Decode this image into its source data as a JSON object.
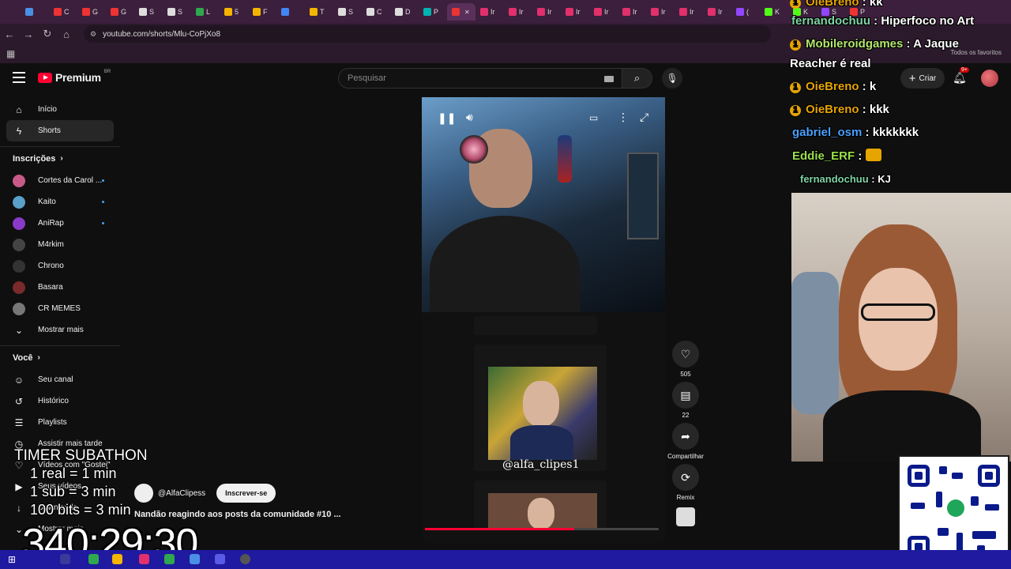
{
  "browser": {
    "url": "youtube.com/shorts/Mlu-CoPjXo8",
    "bookmarks_label": "Todos os favoritos",
    "tabs": [
      {
        "letter": "",
        "color": "#4a8fe6"
      },
      {
        "letter": "C",
        "color": "#ee3333"
      },
      {
        "letter": "G",
        "color": "#ee3333"
      },
      {
        "letter": "G",
        "color": "#ee3333"
      },
      {
        "letter": "S",
        "color": "#dddddd"
      },
      {
        "letter": "S",
        "color": "#dddddd"
      },
      {
        "letter": "L",
        "color": "#2fa84f"
      },
      {
        "letter": "5",
        "color": "#f4b400"
      },
      {
        "letter": "F",
        "color": "#f4b400"
      },
      {
        "letter": "",
        "color": "#4285f4"
      },
      {
        "letter": "T",
        "color": "#f4b400"
      },
      {
        "letter": "S",
        "color": "#dddddd"
      },
      {
        "letter": "C",
        "color": "#dddddd"
      },
      {
        "letter": "D",
        "color": "#dddddd"
      },
      {
        "letter": "P",
        "color": "#00b3b3"
      },
      {
        "letter": "",
        "color": "#ee3333",
        "active": true
      },
      {
        "letter": "Ir",
        "color": "#e1306c"
      },
      {
        "letter": "Ir",
        "color": "#e1306c"
      },
      {
        "letter": "Ir",
        "color": "#e1306c"
      },
      {
        "letter": "Ir",
        "color": "#e1306c"
      },
      {
        "letter": "Ir",
        "color": "#e1306c"
      },
      {
        "letter": "Ir",
        "color": "#e1306c"
      },
      {
        "letter": "Ir",
        "color": "#e1306c"
      },
      {
        "letter": "Ir",
        "color": "#e1306c"
      },
      {
        "letter": "Ir",
        "color": "#e1306c"
      },
      {
        "letter": "(",
        "color": "#9146ff"
      },
      {
        "letter": "K",
        "color": "#53fc18"
      },
      {
        "letter": "K",
        "color": "#53fc18"
      },
      {
        "letter": "S",
        "color": "#9146ff"
      },
      {
        "letter": "P",
        "color": "#ee3333"
      }
    ]
  },
  "youtube": {
    "logo_text": "Premium",
    "logo_region": "BR",
    "search_placeholder": "Pesquisar",
    "create_label": "Criar",
    "notifications_badge": "9+",
    "accent": "#ff0033"
  },
  "sidebar": {
    "main": [
      {
        "label": "Início",
        "icon": "home-icon",
        "glyph": "⌂"
      },
      {
        "label": "Shorts",
        "icon": "shorts-icon",
        "glyph": "ϟ",
        "active": true
      }
    ],
    "subscriptions_title": "Inscrições",
    "subscriptions": [
      {
        "label": "Cortes da Carol ...",
        "color": "#c85a8a",
        "dot": true
      },
      {
        "label": "Kaito",
        "color": "#5aa0c8",
        "dot": true
      },
      {
        "label": "AniRap",
        "color": "#8a3ac8",
        "dot": true
      },
      {
        "label": "M4rkim",
        "color": "#444444",
        "dot": false
      },
      {
        "label": "Chrono",
        "color": "#333333",
        "dot": false
      },
      {
        "label": "Basara",
        "color": "#7a2a2a",
        "dot": false
      },
      {
        "label": "CR MEMES",
        "color": "#777777",
        "dot": false
      }
    ],
    "show_more": "Mostrar mais",
    "you_title": "Você",
    "you": [
      {
        "label": "Seu canal",
        "icon": "channel-icon",
        "glyph": "☺"
      },
      {
        "label": "Histórico",
        "icon": "history-icon",
        "glyph": "↺"
      },
      {
        "label": "Playlists",
        "icon": "playlists-icon",
        "glyph": "☰"
      },
      {
        "label": "Assistir mais tarde",
        "icon": "watch-later-icon",
        "glyph": "◷"
      },
      {
        "label": "Vídeos com \"Gostei\"",
        "icon": "liked-videos-icon",
        "glyph": "♡"
      },
      {
        "label": "Seus vídeos",
        "icon": "your-videos-icon",
        "glyph": "▶"
      },
      {
        "label": "Downloads",
        "icon": "downloads-icon",
        "glyph": "↓"
      },
      {
        "label": "Mostrar mais",
        "icon": "chevron-down-icon",
        "glyph": "⌄"
      }
    ]
  },
  "short": {
    "channel_name": "@AlfaClipess",
    "subscribe_label": "Inscrever-se",
    "title": "Nandão reagindo aos posts da comunidade #10 ...",
    "watermark": "@alfa_clipes1",
    "likes": "505",
    "comments": "22",
    "share_label": "Compartilhar",
    "remix_label": "Remix",
    "progress": 0.64
  },
  "overlay": {
    "subathon_title": "TIMER SUBATHON",
    "rules": [
      "1 real = 1 min",
      "1 sub = 3 min",
      "100 bits = 3 min"
    ],
    "timer": "340:29:30"
  },
  "chat": [
    {
      "user": "OieBreno",
      "msg": "kk",
      "color": "#e6a400",
      "badge": true
    },
    {
      "user": "fernandochuu",
      "msg": "Hiperfoco no Art",
      "color": "#7fd3a3",
      "badge": false
    },
    {
      "user": "Mobileroidgames",
      "msg": "A Jaque",
      "color": "#b3e66b",
      "badge": true
    },
    {
      "user": "",
      "msg": "Reacher é real",
      "color": "#ffffff",
      "badge": false
    },
    {
      "user": "OieBreno",
      "msg": "k",
      "color": "#e6a400",
      "badge": true
    },
    {
      "user": "OieBreno",
      "msg": "kkk",
      "color": "#e6a400",
      "badge": true
    },
    {
      "user": "gabriel_osm",
      "msg": "kkkkkkk",
      "color": "#4aa0ff",
      "badge": false
    },
    {
      "user": "Eddie_ERF",
      "msg": "",
      "color": "#9be04a",
      "badge": false
    },
    {
      "user": "fernandochuu",
      "msg": "KJ",
      "color": "#7fd3a3",
      "badge": false
    }
  ]
}
